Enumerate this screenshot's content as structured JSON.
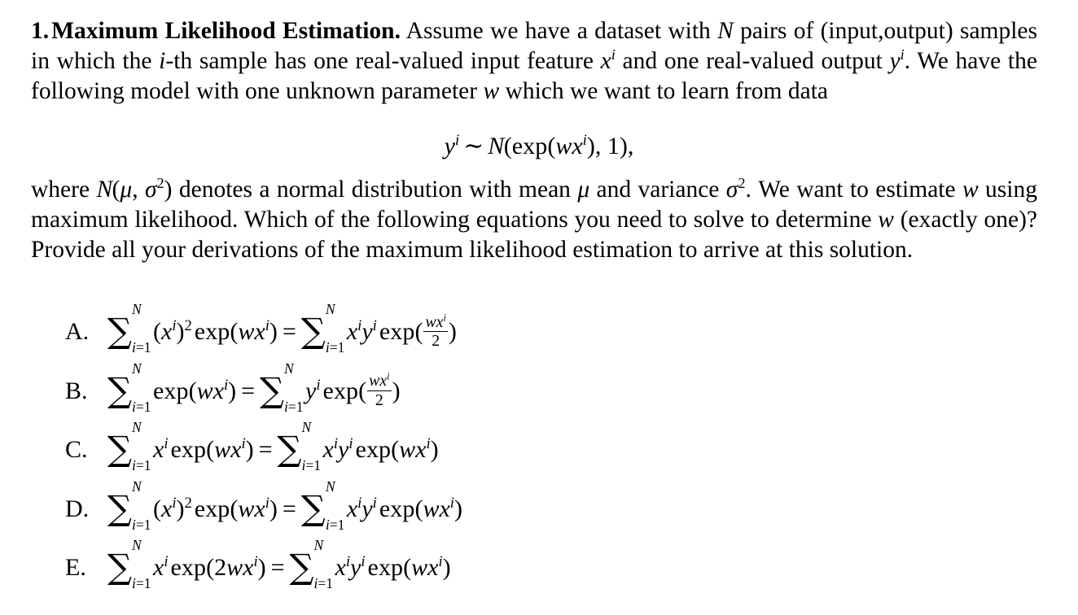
{
  "document": {
    "question_number": "1.",
    "title": "Maximum Likelihood Estimation.",
    "paragraph1": {
      "seg1": "Assume we have a dataset with ",
      "var_N": "N",
      "seg2": " pairs of (input,output) samples in which the ",
      "var_i": "i",
      "seg3": "-th sample has one real-valued input feature ",
      "var_x": "x",
      "sup_i_1": "i",
      "seg4": " and one real-valued output ",
      "var_y": "y",
      "sup_i_2": "i",
      "seg5": ". We have the following model with one unknown parameter ",
      "var_w": "w",
      "seg6": " which we want to learn from data"
    },
    "display_equation": {
      "lhs_var": "y",
      "lhs_sup": "i",
      "relation": "∼",
      "dist_symbol": "N",
      "open": "(",
      "exp_fn": "exp",
      "exp_open": "(",
      "w": "w",
      "x": "x",
      "x_sup": "i",
      "exp_close": ")",
      "comma": ", ",
      "variance": "1",
      "close": ")",
      "trailing": ","
    },
    "paragraph2": {
      "seg1": "where ",
      "cal_n": "N",
      "open": "(",
      "mu": "μ",
      "comma": ", ",
      "sigma": "σ",
      "sigma_sup": "2",
      "close": ")",
      "seg2": " denotes a normal distribution with mean ",
      "mu2": "μ",
      "seg3": " and variance ",
      "sigma2": "σ",
      "sigma2_sup": "2",
      "seg4": ". We want to estimate ",
      "var_w": "w",
      "seg5": " using maximum likelihood. Which of the following equations you need to solve to determine ",
      "var_w2": "w",
      "seg6": " (exactly one)? Provide all your derivations of the maximum likelihood estimation to arrive at this solution."
    },
    "options": [
      {
        "label": "A.",
        "latex": "\\sum_{i=1}^{N}(x^i)^2 \\exp(wx^i) = \\sum_{i=1}^{N} x^i y^i \\exp(\\frac{wx^i}{2})",
        "lhs": {
          "sum_upper": "N",
          "sum_lower_index": "i",
          "sum_lower_eq": "=1",
          "term_open": "(",
          "term_var": "x",
          "term_sup": "i",
          "term_close": ")",
          "term_pow": "2",
          "exp_fn": "exp",
          "exp_open": "(",
          "exp_w": "w",
          "exp_x": "x",
          "exp_x_sup": "i",
          "exp_close": ")"
        },
        "eq": "=",
        "rhs": {
          "sum_upper": "N",
          "sum_lower_index": "i",
          "sum_lower_eq": "=1",
          "var_x": "x",
          "var_x_sup": "i",
          "var_y": "y",
          "var_y_sup": "i",
          "exp_fn": "exp",
          "exp_open": "(",
          "frac_num_w": "w",
          "frac_num_x": "x",
          "frac_num_sup": "i",
          "frac_den": "2",
          "exp_close": ")"
        }
      },
      {
        "label": "B.",
        "latex": "\\sum_{i=1}^{N} \\exp(wx^i) = \\sum_{i=1}^{N} y^i \\exp(\\frac{wx^i}{2})",
        "lhs": {
          "sum_upper": "N",
          "sum_lower_index": "i",
          "sum_lower_eq": "=1",
          "exp_fn": "exp",
          "exp_open": "(",
          "exp_w": "w",
          "exp_x": "x",
          "exp_x_sup": "i",
          "exp_close": ")"
        },
        "eq": "=",
        "rhs": {
          "sum_upper": "N",
          "sum_lower_index": "i",
          "sum_lower_eq": "=1",
          "var_y": "y",
          "var_y_sup": "i",
          "exp_fn": "exp",
          "exp_open": "(",
          "frac_num_w": "w",
          "frac_num_x": "x",
          "frac_num_sup": "i",
          "frac_den": "2",
          "exp_close": ")"
        }
      },
      {
        "label": "C.",
        "latex": "\\sum_{i=1}^{N} x^i \\exp(wx^i) = \\sum_{i=1}^{N} x^i y^i \\exp(wx^i)",
        "lhs": {
          "sum_upper": "N",
          "sum_lower_index": "i",
          "sum_lower_eq": "=1",
          "var_x": "x",
          "var_x_sup": "i",
          "exp_fn": "exp",
          "exp_open": "(",
          "exp_w": "w",
          "exp_x": "x",
          "exp_x_sup": "i",
          "exp_close": ")"
        },
        "eq": "=",
        "rhs": {
          "sum_upper": "N",
          "sum_lower_index": "i",
          "sum_lower_eq": "=1",
          "var_x": "x",
          "var_x_sup": "i",
          "var_y": "y",
          "var_y_sup": "i",
          "exp_fn": "exp",
          "exp_open": "(",
          "exp_w": "w",
          "exp_x": "x",
          "exp_x_sup": "i",
          "exp_close": ")"
        }
      },
      {
        "label": "D.",
        "latex": "\\sum_{i=1}^{N}(x^i)^2 \\exp(wx^i) = \\sum_{i=1}^{N} x^i y^i \\exp(wx^i)",
        "lhs": {
          "sum_upper": "N",
          "sum_lower_index": "i",
          "sum_lower_eq": "=1",
          "term_open": "(",
          "term_var": "x",
          "term_sup": "i",
          "term_close": ")",
          "term_pow": "2",
          "exp_fn": "exp",
          "exp_open": "(",
          "exp_w": "w",
          "exp_x": "x",
          "exp_x_sup": "i",
          "exp_close": ")"
        },
        "eq": "=",
        "rhs": {
          "sum_upper": "N",
          "sum_lower_index": "i",
          "sum_lower_eq": "=1",
          "var_x": "x",
          "var_x_sup": "i",
          "var_y": "y",
          "var_y_sup": "i",
          "exp_fn": "exp",
          "exp_open": "(",
          "exp_w": "w",
          "exp_x": "x",
          "exp_x_sup": "i",
          "exp_close": ")"
        }
      },
      {
        "label": "E.",
        "latex": "\\sum_{i=1}^{N} x^i \\exp(2wx^i) = \\sum_{i=1}^{N} x^i y^i \\exp(wx^i)",
        "lhs": {
          "sum_upper": "N",
          "sum_lower_index": "i",
          "sum_lower_eq": "=1",
          "var_x": "x",
          "var_x_sup": "i",
          "exp_fn": "exp",
          "exp_open": "(",
          "coef": "2",
          "exp_w": "w",
          "exp_x": "x",
          "exp_x_sup": "i",
          "exp_close": ")"
        },
        "eq": "=",
        "rhs": {
          "sum_upper": "N",
          "sum_lower_index": "i",
          "sum_lower_eq": "=1",
          "var_x": "x",
          "var_x_sup": "i",
          "var_y": "y",
          "var_y_sup": "i",
          "exp_fn": "exp",
          "exp_open": "(",
          "exp_w": "w",
          "exp_x": "x",
          "exp_x_sup": "i",
          "exp_close": ")"
        }
      }
    ],
    "colors": {
      "background": "#ffffff",
      "text": "#000000"
    }
  }
}
